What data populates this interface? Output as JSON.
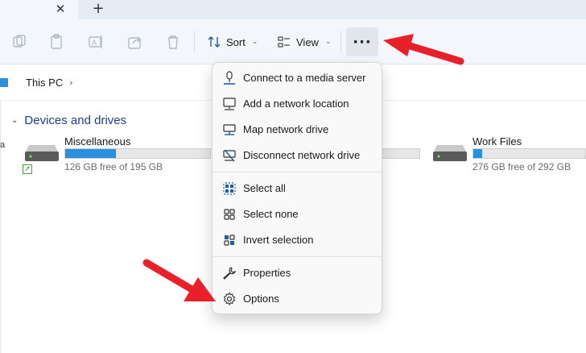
{
  "tabs": {
    "close_glyph": "✕",
    "new_glyph": "+"
  },
  "toolbar": {
    "icons": [
      "cut-icon",
      "copy-icon",
      "rename-icon",
      "share-icon",
      "delete-icon"
    ],
    "sort_label": "Sort",
    "view_label": "View",
    "chevron": "⌄",
    "more_glyph": "···"
  },
  "address": {
    "location": "This PC",
    "separator": "›"
  },
  "content": {
    "group_header": "Devices and drives",
    "group_chevron": "⌄",
    "left_edge_char": "a",
    "drives": [
      {
        "name": "Miscellaneous",
        "free_text": "126 GB free of 195 GB",
        "used_fraction": 0.35
      },
      {
        "name": "Work Files",
        "free_text": "276 GB free of 292 GB",
        "used_fraction": 0.08
      }
    ],
    "accent_color": "#2b8fe0"
  },
  "menu": {
    "items": [
      {
        "label": "Connect to a media server",
        "icon": "media-server-icon"
      },
      {
        "label": "Add a network location",
        "icon": "network-location-icon"
      },
      {
        "label": "Map network drive",
        "icon": "map-network-drive-icon"
      },
      {
        "label": "Disconnect network drive",
        "icon": "disconnect-drive-icon"
      },
      {
        "label": "Select all",
        "icon": "select-all-icon"
      },
      {
        "label": "Select none",
        "icon": "select-none-icon"
      },
      {
        "label": "Invert selection",
        "icon": "invert-selection-icon"
      },
      {
        "label": "Properties",
        "icon": "wrench-icon"
      },
      {
        "label": "Options",
        "icon": "gear-icon"
      }
    ]
  },
  "annotations": {
    "arrow_color": "#e8202a"
  }
}
